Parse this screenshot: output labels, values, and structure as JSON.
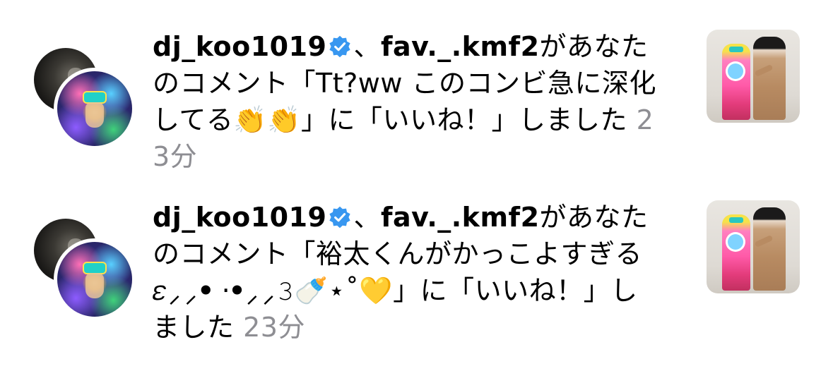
{
  "notifications": [
    {
      "users": [
        "dj_koo1019",
        "fav._.kmf2"
      ],
      "separator": "、",
      "message_prefix": "があなたのコメント「",
      "comment": "Tt?ww このコンビ急に深化してる👏👏",
      "message_suffix": "」に「いいね！」しました",
      "time": "23分",
      "verified_icon": "verified-badge-icon",
      "colors": {
        "verified": "#3897f0",
        "time": "#8e8e93"
      }
    },
    {
      "users": [
        "dj_koo1019",
        "fav._.kmf2"
      ],
      "separator": "、",
      "message_prefix": "があなたのコメント「",
      "comment": "裕太くんがかっこよすぎる𝜀⸝⸝ꔷ ·ꔷ⸝⸝𝟹🍼⋆˚💛",
      "message_suffix": "」に「いいね！」しました",
      "time": "23分",
      "verified_icon": "verified-badge-icon",
      "colors": {
        "verified": "#3897f0",
        "time": "#8e8e93"
      }
    }
  ]
}
